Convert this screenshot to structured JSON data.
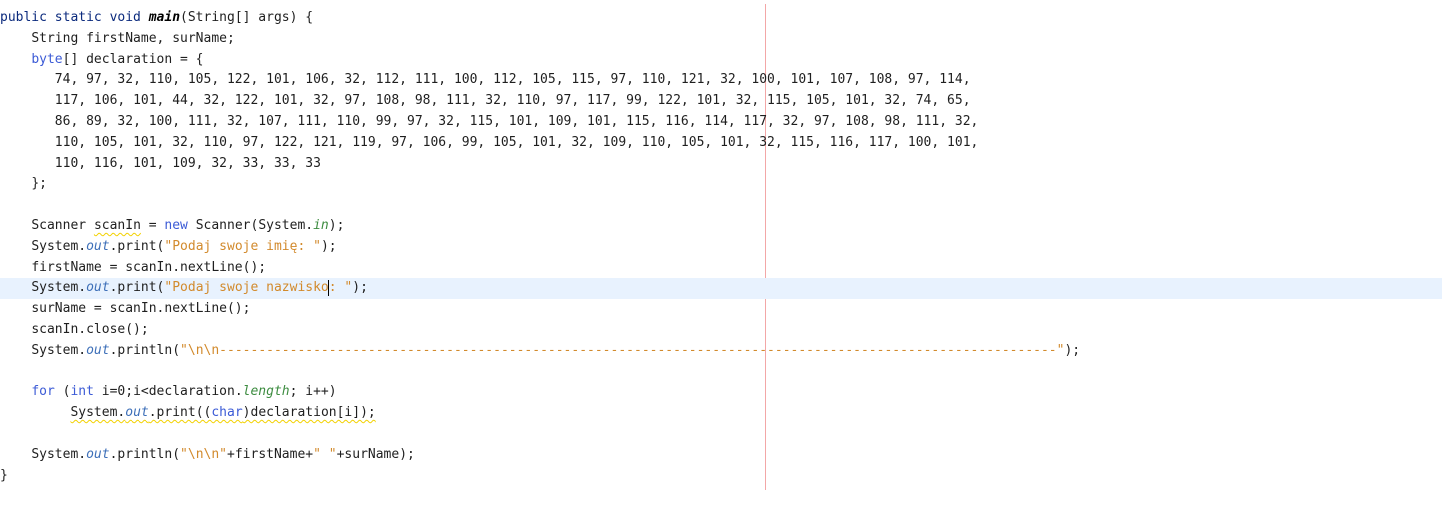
{
  "editor": {
    "language": "java",
    "caret": {
      "line": 14
    },
    "colors": {
      "keyword": "#0b2a7d",
      "keyword_blue": "#3c5bd6",
      "string": "#d28a2c",
      "field": "#3d8c40",
      "static_member": "#3d6fb8",
      "text": "#1f1f1f",
      "current_line_bg": "#e8f2fe",
      "print_margin": "#f3a7a7",
      "warning_underline": "#f2d100"
    },
    "lines": [
      {
        "indent": "",
        "tokens": [
          {
            "t": "public static void ",
            "c": "kw"
          },
          {
            "t": "main",
            "c": "mth"
          },
          {
            "t": "(String[] args) {"
          }
        ]
      },
      {
        "indent": "    ",
        "tokens": [
          {
            "t": "String firstName, surName;"
          }
        ]
      },
      {
        "indent": "    ",
        "tokens": [
          {
            "t": "byte",
            "c": "kwb"
          },
          {
            "t": "[] declaration = {"
          }
        ]
      },
      {
        "indent": "       ",
        "tokens": [
          {
            "t": "74, 97, 32, 110, 105, 122, 101, 106, 32, 112, 111, 100, 112, 105, 115, 97, 110, 121, 32, 100, 101, 107, 108, 97, 114,"
          }
        ]
      },
      {
        "indent": "       ",
        "tokens": [
          {
            "t": "117, 106, 101, 44, 32, 122, 101, 32, 97, 108, 98, 111, 32, 110, 97, 117, 99, 122, 101, 32, 115, 105, 101, 32, 74, 65,"
          }
        ]
      },
      {
        "indent": "       ",
        "tokens": [
          {
            "t": "86, 89, 32, 100, 111, 32, 107, 111, 110, 99, 97, 32, 115, 101, 109, 101, 115, 116, 114, 117, 32, 97, 108, 98, 111, 32,"
          }
        ]
      },
      {
        "indent": "       ",
        "tokens": [
          {
            "t": "110, 105, 101, 32, 110, 97, 122, 121, 119, 97, 106, 99, 105, 101, 32, 109, 110, 105, 101, 32, 115, 116, 117, 100, 101,"
          }
        ]
      },
      {
        "indent": "       ",
        "tokens": [
          {
            "t": "110, 116, 101, 109, 32, 33, 33, 33"
          }
        ]
      },
      {
        "indent": "    ",
        "tokens": [
          {
            "t": "};"
          }
        ]
      },
      {
        "indent": "",
        "tokens": []
      },
      {
        "indent": "    ",
        "tokens": [
          {
            "t": "Scanner "
          },
          {
            "t": "scanIn",
            "w": true
          },
          {
            "t": " = "
          },
          {
            "t": "new",
            "c": "kwb"
          },
          {
            "t": " Scanner(System."
          },
          {
            "t": "in",
            "c": "fld"
          },
          {
            "t": ");"
          }
        ]
      },
      {
        "indent": "    ",
        "tokens": [
          {
            "t": "System."
          },
          {
            "t": "out",
            "c": "st"
          },
          {
            "t": ".print("
          },
          {
            "t": "\"Podaj swoje imię: \"",
            "c": "str"
          },
          {
            "t": ");"
          }
        ]
      },
      {
        "indent": "    ",
        "tokens": [
          {
            "t": "firstName = scanIn.nextLine();"
          }
        ]
      },
      {
        "indent": "    ",
        "tokens": [
          {
            "t": "System."
          },
          {
            "t": "out",
            "c": "st"
          },
          {
            "t": ".print("
          },
          {
            "t": "\"Podaj swoje nazwisko",
            "c": "str"
          },
          {
            "caret": true
          },
          {
            "t": ": \"",
            "c": "str"
          },
          {
            "t": ");"
          }
        ]
      },
      {
        "indent": "    ",
        "tokens": [
          {
            "t": "surName = scanIn.nextLine();"
          }
        ]
      },
      {
        "indent": "    ",
        "tokens": [
          {
            "t": "scanIn.close();"
          }
        ]
      },
      {
        "indent": "    ",
        "tokens": [
          {
            "t": "System."
          },
          {
            "t": "out",
            "c": "st"
          },
          {
            "t": ".println("
          },
          {
            "t": "\"\\n\\n-----------------------------------------------------------------------------------------------------------\"",
            "c": "str"
          },
          {
            "t": ");"
          }
        ]
      },
      {
        "indent": "",
        "tokens": []
      },
      {
        "indent": "    ",
        "tokens": [
          {
            "t": "for",
            "c": "kwb"
          },
          {
            "t": " ("
          },
          {
            "t": "int",
            "c": "kwb"
          },
          {
            "t": " i=0;i<declaration."
          },
          {
            "t": "length",
            "c": "fld"
          },
          {
            "t": "; i++)"
          }
        ]
      },
      {
        "indent": "         ",
        "tokens": [
          {
            "t": "System.",
            "w": true
          },
          {
            "t": "out",
            "c": "st",
            "w": true
          },
          {
            "t": ".print((",
            "w": true
          },
          {
            "t": "char",
            "c": "kwb",
            "w": true
          },
          {
            "t": ")declaration[i]);",
            "w": true
          }
        ]
      },
      {
        "indent": "",
        "tokens": []
      },
      {
        "indent": "    ",
        "tokens": [
          {
            "t": "System."
          },
          {
            "t": "out",
            "c": "st"
          },
          {
            "t": ".println("
          },
          {
            "t": "\"\\n\\n\"",
            "c": "str"
          },
          {
            "t": "+firstName+"
          },
          {
            "t": "\" \"",
            "c": "str"
          },
          {
            "t": "+surName);"
          }
        ]
      },
      {
        "indent": "",
        "tokens": [
          {
            "t": "}"
          }
        ]
      }
    ]
  }
}
